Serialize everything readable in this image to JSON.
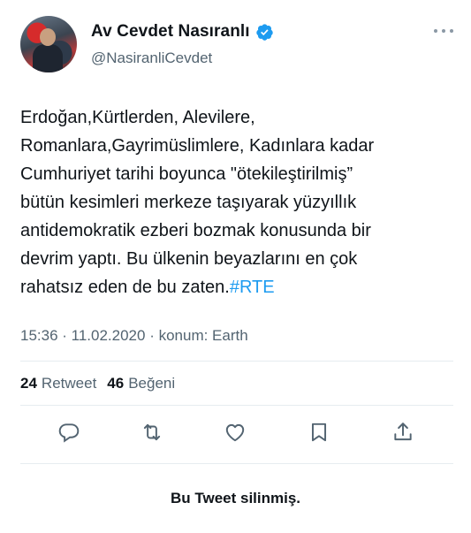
{
  "author": {
    "display_name": "Av Cevdet Nasıranlı",
    "handle": "@NasiranliCevdet",
    "verified": true
  },
  "tweet": {
    "lines": [
      "Erdoğan,Kürtlerden, Alevilere,",
      "Romanlara,Gayrimüslimlere, Kadınlara kadar",
      "Cumhuriyet tarihi boyunca \"ötekileştirilmiş”",
      "bütün kesimleri merkeze taşıyarak yüzyıllık",
      "antidemokratik ezberi bozmak konusunda bir",
      "devrim yaptı. Bu ülkenin beyazlarını en çok"
    ],
    "last_line_text": "rahatsız eden de bu zaten.",
    "hashtag": "#RTE",
    "meta": "15:36 · 11.02.2020 · konum: Earth"
  },
  "stats": {
    "retweets_count": "24",
    "retweets_label": "Retweet",
    "likes_count": "46",
    "likes_label": "Beğeni"
  },
  "actions": {
    "icons": [
      "reply-icon",
      "retweet-icon",
      "like-icon",
      "bookmark-icon",
      "share-icon"
    ]
  },
  "notice": "Bu Tweet silinmiş.",
  "colors": {
    "text": "#0f1419",
    "secondary": "#536471",
    "accent": "#1d9bf0",
    "divider": "#e6ecf0"
  }
}
